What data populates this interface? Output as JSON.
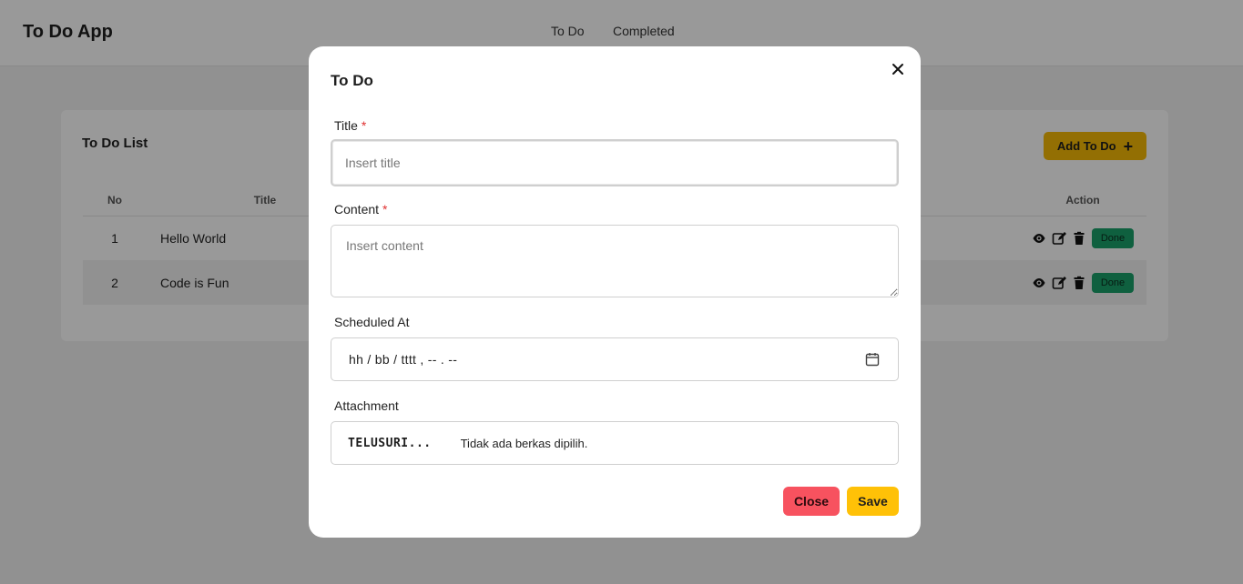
{
  "navbar": {
    "brand": "To Do App",
    "links": [
      "To Do",
      "Completed"
    ]
  },
  "card": {
    "title": "To Do List",
    "add_button": "Add To Do",
    "add_icon": "plus-icon",
    "columns": [
      "No",
      "Title",
      "Action"
    ],
    "rows": [
      {
        "no": "1",
        "title": "Hello World",
        "done_label": "Done"
      },
      {
        "no": "2",
        "title": "Code is Fun",
        "done_label": "Done"
      }
    ],
    "row_icons": [
      "eye-icon",
      "edit-icon",
      "trash-icon"
    ]
  },
  "modal": {
    "title": "To Do",
    "close_icon": "close-icon",
    "fields": {
      "title": {
        "label": "Title",
        "required_mark": "*",
        "placeholder": "Insert title",
        "value": ""
      },
      "content": {
        "label": "Content",
        "required_mark": "*",
        "placeholder": "Insert content",
        "value": ""
      },
      "scheduled": {
        "label": "Scheduled At",
        "display": "hh / bb / tttt ,  -- . --",
        "icon": "calendar-icon"
      },
      "attachment": {
        "label": "Attachment",
        "button": "TELUSURI...",
        "status": "Tidak ada berkas dipilih."
      }
    },
    "buttons": {
      "close": "Close",
      "save": "Save"
    }
  },
  "colors": {
    "accent_yellow": "#ffc107",
    "danger_red": "#f7525f",
    "success_green": "#1aa06a",
    "overlay": "rgba(0,0,0,0.4)"
  }
}
